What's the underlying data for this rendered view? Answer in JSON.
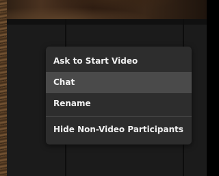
{
  "context_menu": {
    "items": [
      {
        "label": "Ask to Start Video"
      },
      {
        "label": "Chat",
        "selected": true
      },
      {
        "label": "Rename"
      }
    ],
    "secondary_items": [
      {
        "label": "Hide Non-Video Participants"
      }
    ]
  },
  "colors": {
    "menu_background": "#2d2d2d",
    "menu_highlight": "#4a4a4a",
    "menu_text": "#f2f2f2",
    "panel_background": "#1b1b1b"
  }
}
